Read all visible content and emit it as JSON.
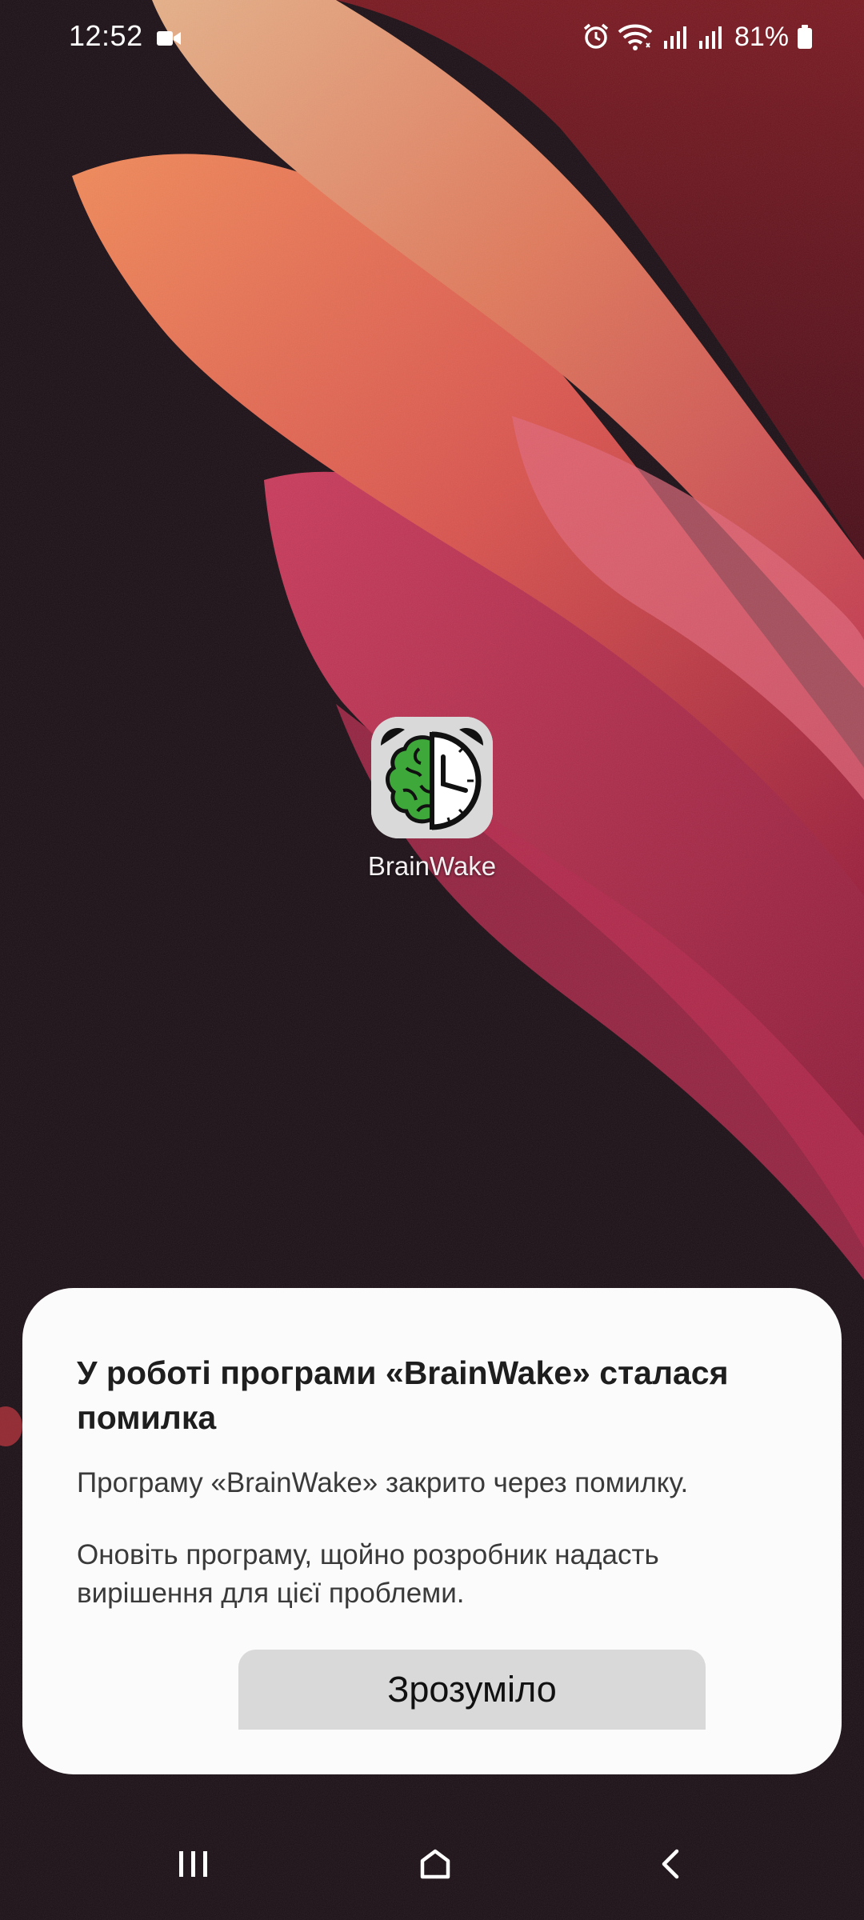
{
  "status_bar": {
    "time": "12:52",
    "battery_percent": "81%",
    "icons": [
      "video-recording-icon",
      "alarm-icon",
      "wifi-icon",
      "signal-sim1-icon",
      "signal-sim2-icon",
      "battery-icon"
    ]
  },
  "home": {
    "app_label": "BrainWake",
    "app_icon": "brain-clock-icon"
  },
  "dialog": {
    "title": "У роботі програми «BrainWake» сталася помилка",
    "message_1": "Програму «BrainWake» закрито через помилку.",
    "message_2": "Оновіть програму, щойно розробник надасть вирішення для цієї проблеми.",
    "ok_label": "Зрозуміло"
  },
  "navigation": {
    "buttons": [
      "recents-icon",
      "home-icon",
      "back-icon"
    ]
  },
  "colors": {
    "dialog_bg": "#fbfbfb",
    "button_bg": "#d9d9d9",
    "wallpaper_dark": "#1c1117",
    "wallpaper_accent": "#d64f5a"
  }
}
